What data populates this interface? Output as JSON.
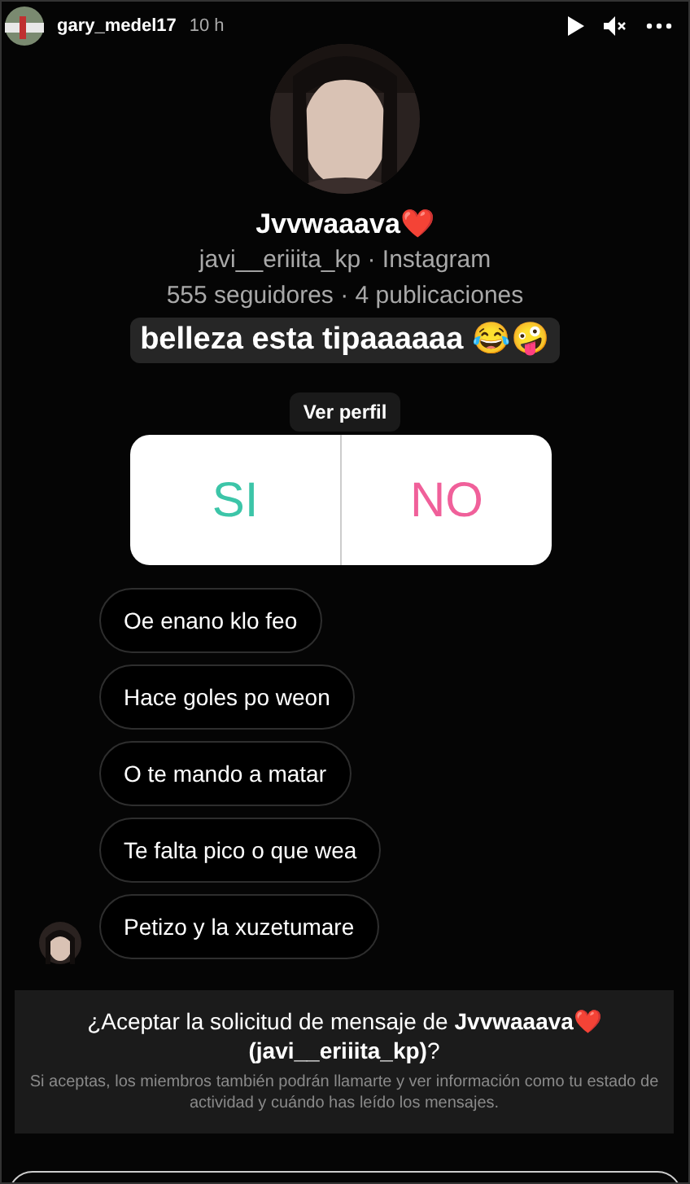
{
  "story_header": {
    "username": "gary_medel17",
    "time": "10 h"
  },
  "profile": {
    "name": "Jvvwaaava❤️",
    "handle": "javi__eriiita_kp · Instagram",
    "stats": "555 seguidores · 4 publicaciones",
    "button": "Ver perfil"
  },
  "caption": "belleza esta tipaaaaaa 😂🤪",
  "poll": {
    "options": [
      "SI",
      "NO"
    ]
  },
  "messages": [
    "Oe enano klo feo",
    "Hace goles po weon",
    "O te mando a matar",
    "Te falta pico o que wea",
    "Petizo y la xuzetumare"
  ],
  "request": {
    "title": "¿Aceptar la solicitud de mensaje de **Jvvwaaava❤️ (javi__eriiita_kp)**?",
    "body": "Si aceptas, los miembros también podrán llamarte y ver información como tu estado de actividad y cuándo has leído los mensajes."
  }
}
